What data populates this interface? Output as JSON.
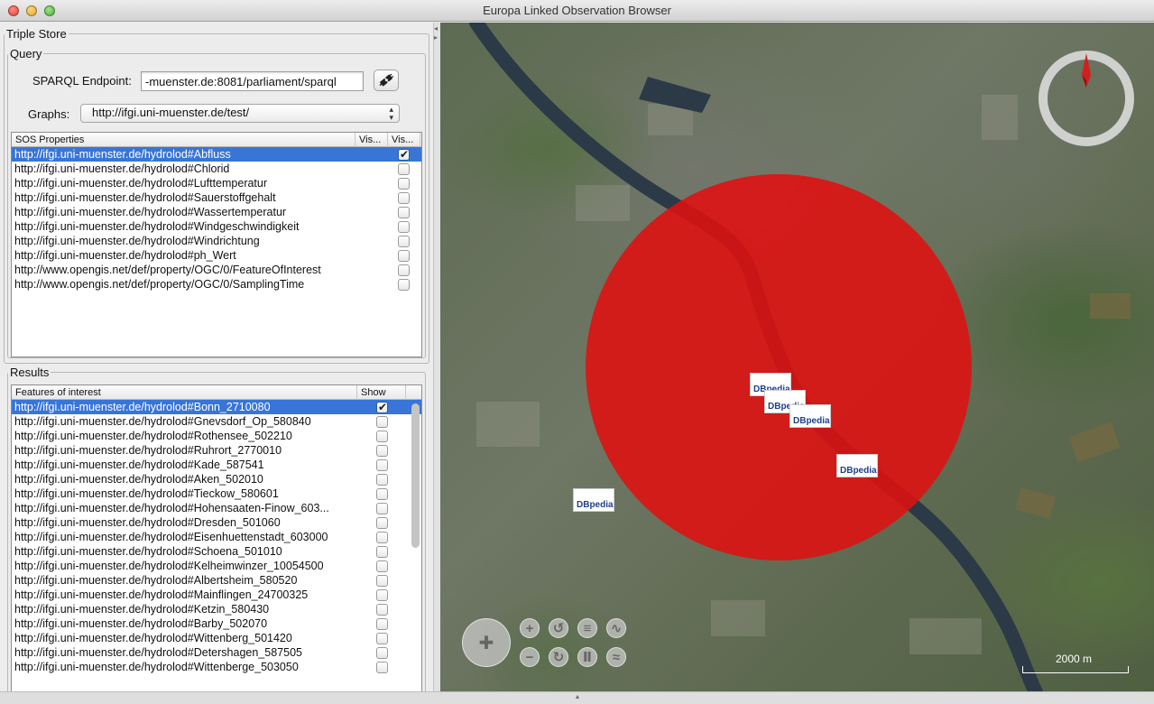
{
  "window": {
    "title": "Europa Linked Observation Browser"
  },
  "triple_store": {
    "legend": "Triple Store",
    "query": {
      "legend": "Query",
      "endpoint_label": "SPARQL Endpoint:",
      "endpoint_value": "-muenster.de:8081/parliament/sparql",
      "graphs_label": "Graphs:",
      "graphs_value": "http://ifgi.uni-muenster.de/test/"
    },
    "properties_table": {
      "headers": [
        "SOS Properties",
        "Vis...",
        "Vis..."
      ],
      "rows": [
        {
          "uri": "http://ifgi.uni-muenster.de/hydrolod#Abfluss",
          "checked": true,
          "selected": true
        },
        {
          "uri": "http://ifgi.uni-muenster.de/hydrolod#Chlorid",
          "checked": false
        },
        {
          "uri": "http://ifgi.uni-muenster.de/hydrolod#Lufttemperatur",
          "checked": false
        },
        {
          "uri": "http://ifgi.uni-muenster.de/hydrolod#Sauerstoffgehalt",
          "checked": false
        },
        {
          "uri": "http://ifgi.uni-muenster.de/hydrolod#Wassertemperatur",
          "checked": false
        },
        {
          "uri": "http://ifgi.uni-muenster.de/hydrolod#Windgeschwindigkeit",
          "checked": false
        },
        {
          "uri": "http://ifgi.uni-muenster.de/hydrolod#Windrichtung",
          "checked": false
        },
        {
          "uri": "http://ifgi.uni-muenster.de/hydrolod#ph_Wert",
          "checked": false
        },
        {
          "uri": "http://www.opengis.net/def/property/OGC/0/FeatureOfInterest",
          "checked": false
        },
        {
          "uri": "http://www.opengis.net/def/property/OGC/0/SamplingTime",
          "checked": false
        }
      ]
    }
  },
  "results": {
    "legend": "Results",
    "headers": [
      "Features of interest",
      "Show"
    ],
    "rows": [
      {
        "uri": "http://ifgi.uni-muenster.de/hydrolod#Bonn_2710080",
        "checked": true,
        "selected": true
      },
      {
        "uri": "http://ifgi.uni-muenster.de/hydrolod#Gnevsdorf_Op_580840",
        "checked": false
      },
      {
        "uri": "http://ifgi.uni-muenster.de/hydrolod#Rothensee_502210",
        "checked": false
      },
      {
        "uri": "http://ifgi.uni-muenster.de/hydrolod#Ruhrort_2770010",
        "checked": false
      },
      {
        "uri": "http://ifgi.uni-muenster.de/hydrolod#Kade_587541",
        "checked": false
      },
      {
        "uri": "http://ifgi.uni-muenster.de/hydrolod#Aken_502010",
        "checked": false
      },
      {
        "uri": "http://ifgi.uni-muenster.de/hydrolod#Tieckow_580601",
        "checked": false
      },
      {
        "uri": "http://ifgi.uni-muenster.de/hydrolod#Hohensaaten-Finow_603...",
        "checked": false
      },
      {
        "uri": "http://ifgi.uni-muenster.de/hydrolod#Dresden_501060",
        "checked": false
      },
      {
        "uri": "http://ifgi.uni-muenster.de/hydrolod#Eisenhuettenstadt_603000",
        "checked": false
      },
      {
        "uri": "http://ifgi.uni-muenster.de/hydrolod#Schoena_501010",
        "checked": false
      },
      {
        "uri": "http://ifgi.uni-muenster.de/hydrolod#Kelheimwinzer_10054500",
        "checked": false
      },
      {
        "uri": "http://ifgi.uni-muenster.de/hydrolod#Albertsheim_580520",
        "checked": false
      },
      {
        "uri": "http://ifgi.uni-muenster.de/hydrolod#Mainflingen_24700325",
        "checked": false
      },
      {
        "uri": "http://ifgi.uni-muenster.de/hydrolod#Ketzin_580430",
        "checked": false
      },
      {
        "uri": "http://ifgi.uni-muenster.de/hydrolod#Barby_502070",
        "checked": false
      },
      {
        "uri": "http://ifgi.uni-muenster.de/hydrolod#Wittenberg_501420",
        "checked": false
      },
      {
        "uri": "http://ifgi.uni-muenster.de/hydrolod#Detershagen_587505",
        "checked": false
      },
      {
        "uri": "http://ifgi.uni-muenster.de/hydrolod#Wittenberge_503050",
        "checked": false
      }
    ]
  },
  "map": {
    "scale_label": "2000 m",
    "marker_label": "DBpedia",
    "highlight_color": "#e01010",
    "river_color": "#2b3a46"
  }
}
